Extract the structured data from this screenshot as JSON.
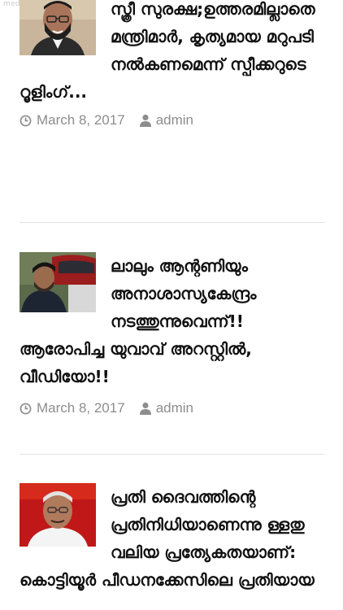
{
  "watermark": "mediaone TV",
  "articles": [
    {
      "title": "സ്ത്രീ സുരക്ഷ;ഉത്തരമില്ലാതെ മന്ത്രിമാർ, കൃത്യമായ മറുപടി നൽകണമെന്ന് സ്പീക്കറുടെ റൂളിംഗ്...",
      "date": "March 8, 2017",
      "author": "admin",
      "thumb_icon": "portrait-man-glasses"
    },
    {
      "title": "ലാലും ആന്റണിയും അനാശാസ്യകേന്ദ്രം നടത്തുന്നുവെന്ന്!! ആരോപിച്ച യുവാവ് അറസ്റ്റിൽ, വീഡിയോ!!",
      "date": "March 8, 2017",
      "author": "admin",
      "thumb_icon": "portrait-man-car"
    },
    {
      "title": "പ്രതി ദൈവത്തിന്റെ പ്രതിനിധിയാണെന്നു ള്ളതു വലിയ പ്രത്യേകതയാണ്: കൊട്ടിയൂർ പീഡനക്കേസിലെ പ്രതിയായ",
      "date": "",
      "author": "",
      "thumb_icon": "portrait-man-red"
    }
  ],
  "colors": {
    "meta_text": "#8d8d8d",
    "divider": "#e3e3e3",
    "title_text": "#111111"
  },
  "icons": {
    "date": "clock-icon",
    "author": "user-icon"
  }
}
